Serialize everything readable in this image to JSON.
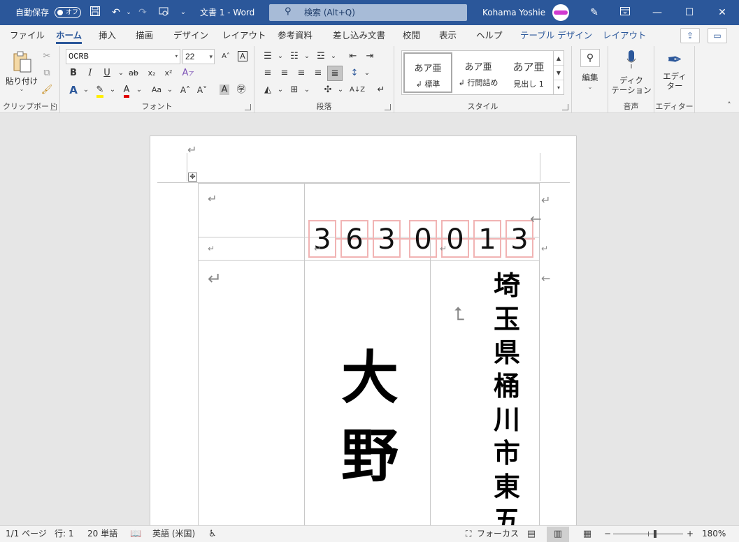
{
  "titlebar": {
    "autosave_label": "自動保存",
    "autosave_state": "オフ",
    "doc_title": "文書 1  -  Word",
    "search_placeholder": "検索 (Alt+Q)",
    "user_name": "Kohama Yoshie",
    "icons": [
      "save-icon",
      "undo-icon",
      "redo-icon",
      "touch-mode-icon",
      "customize-icon",
      "pen-icon",
      "ribbon-display-icon",
      "minimize-icon",
      "restore-icon",
      "close-icon"
    ]
  },
  "tabs": [
    "ファイル",
    "ホーム",
    "挿入",
    "描画",
    "デザイン",
    "レイアウト",
    "参考資料",
    "差し込み文書",
    "校閲",
    "表示",
    "ヘルプ",
    "テーブル デザイン",
    "レイアウト"
  ],
  "active_tab": "ホーム",
  "ribbon": {
    "clipboard": {
      "paste_label": "貼り付け",
      "group_label": "クリップボード"
    },
    "font": {
      "font_name": "OCRB",
      "font_size": "22",
      "group_label": "フォント",
      "bold": "B",
      "italic": "I",
      "underline": "U",
      "strike": "ab",
      "subscript": "x₂",
      "superscript": "x²",
      "change_case": "Aa"
    },
    "paragraph": {
      "group_label": "段落"
    },
    "styles": {
      "group_label": "スタイル",
      "items": [
        {
          "sample": "あア亜",
          "name": "↲ 標準",
          "selected": true
        },
        {
          "sample": "あア亜",
          "name": "↲ 行間詰め",
          "selected": false
        },
        {
          "sample": "あア亜",
          "name": "見出し 1",
          "selected": false
        }
      ]
    },
    "editing": {
      "label": "編集"
    },
    "voice": {
      "label_line1": "ディク",
      "label_line2": "テーション",
      "group_label": "音声"
    },
    "editor": {
      "label_line1": "エディ",
      "label_line2": "ター",
      "group_label": "エディター"
    }
  },
  "document": {
    "postal_code": [
      "3",
      "6",
      "3",
      "0",
      "0",
      "1",
      "3"
    ],
    "recipient_name": [
      "大",
      "野"
    ],
    "address": [
      "埼",
      "玉",
      "県",
      "桶",
      "川",
      "市",
      "東",
      "五"
    ],
    "paragraph_mark": "↵",
    "end_of_cell_mark": "←"
  },
  "statusbar": {
    "page": "1/1 ページ",
    "line": "行: 1",
    "words": "20 単語",
    "language": "英語 (米国)",
    "focus": "フォーカス",
    "zoom_minus": "−",
    "zoom_plus": "+",
    "zoom": "180%"
  }
}
